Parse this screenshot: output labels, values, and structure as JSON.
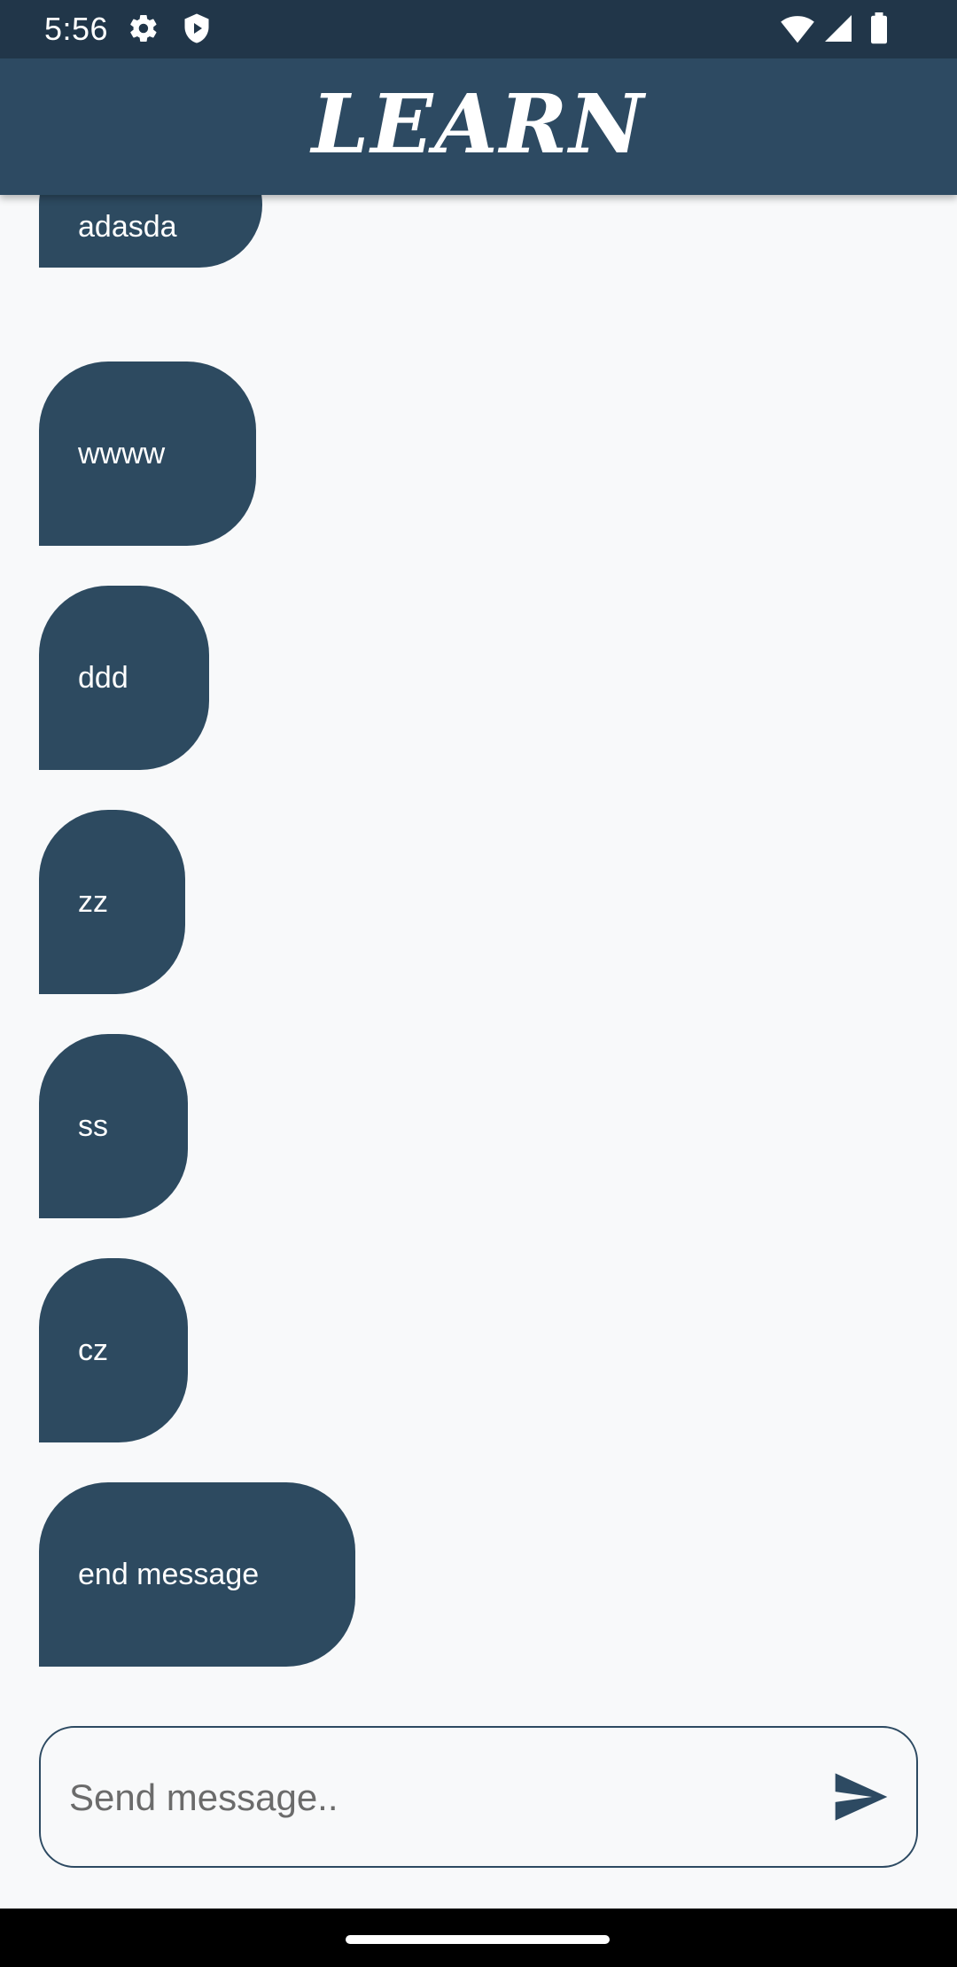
{
  "status_bar": {
    "time": "5:56",
    "icons": [
      "gear-icon",
      "shield-icon",
      "wifi-icon",
      "signal-icon",
      "battery-icon"
    ]
  },
  "app_bar": {
    "title": "LEARN"
  },
  "messages": [
    {
      "text": "adasda"
    },
    {
      "text": "wwww"
    },
    {
      "text": "ddd"
    },
    {
      "text": "zz"
    },
    {
      "text": "ss"
    },
    {
      "text": "cz"
    },
    {
      "text": "end message"
    }
  ],
  "composer": {
    "placeholder": "Send message..",
    "value": "",
    "send_icon": "send-icon"
  },
  "colors": {
    "status_bar": "#213649",
    "app_bar": "#2d4a62",
    "bubble": "#2d4a60",
    "background": "#f8f9fa"
  }
}
